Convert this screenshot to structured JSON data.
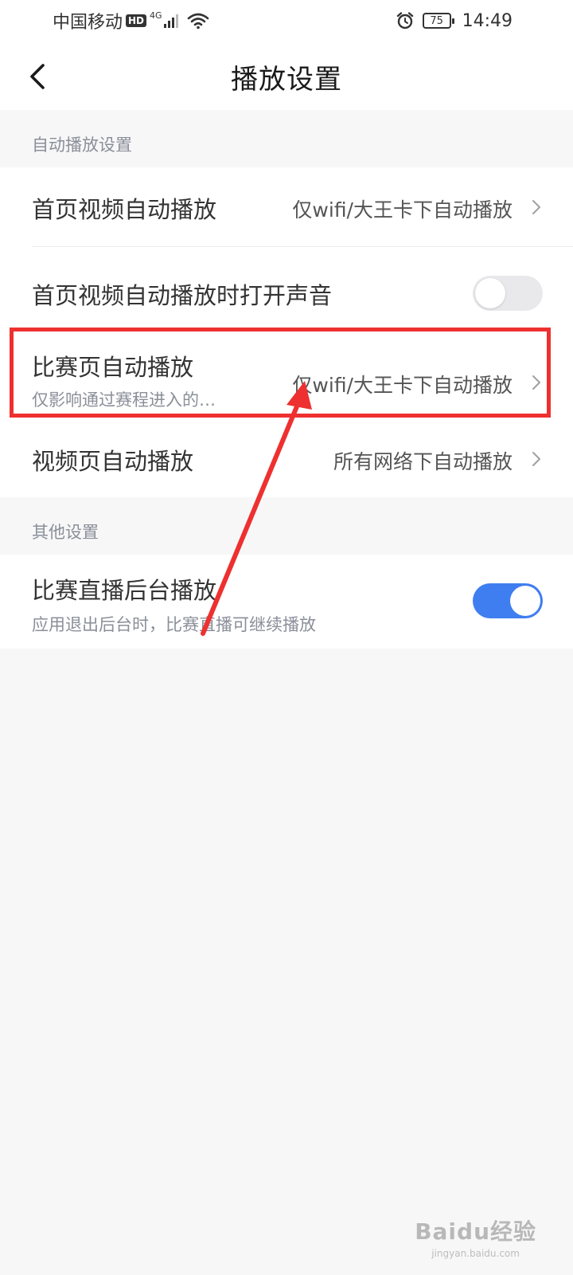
{
  "status_bar": {
    "carrier": "中国移动",
    "hd_badge": "HD",
    "network": "4G",
    "battery": "75",
    "time": "14:49"
  },
  "header": {
    "title": "播放设置",
    "back_icon": "chevron-left-icon"
  },
  "sections": [
    {
      "label": "自动播放设置",
      "rows": [
        {
          "title": "首页视频自动播放",
          "value": "仅wifi/大王卡下自动播放",
          "control": "chevron"
        },
        {
          "title": "首页视频自动播放时打开声音",
          "control": "toggle",
          "toggle_on": false
        },
        {
          "title": "比赛页自动播放",
          "subtitle": "仅影响通过赛程进入的…",
          "value": "仅wifi/大王卡下自动播放",
          "control": "chevron"
        },
        {
          "title": "视频页自动播放",
          "value": "所有网络下自动播放",
          "control": "chevron"
        }
      ]
    },
    {
      "label": "其他设置",
      "rows": [
        {
          "title": "比赛直播后台播放",
          "subtitle": "应用退出后台时，比赛直播可继续播放",
          "control": "toggle",
          "toggle_on": true
        }
      ]
    }
  ],
  "colors": {
    "toggle_on": "#3f7ef0",
    "toggle_off": "#e9e9ec",
    "annotation": "#ee3030",
    "background": "#f7f7f8"
  },
  "watermark": {
    "logo": "Baidu经验",
    "url": "jingyan.baidu.com"
  }
}
